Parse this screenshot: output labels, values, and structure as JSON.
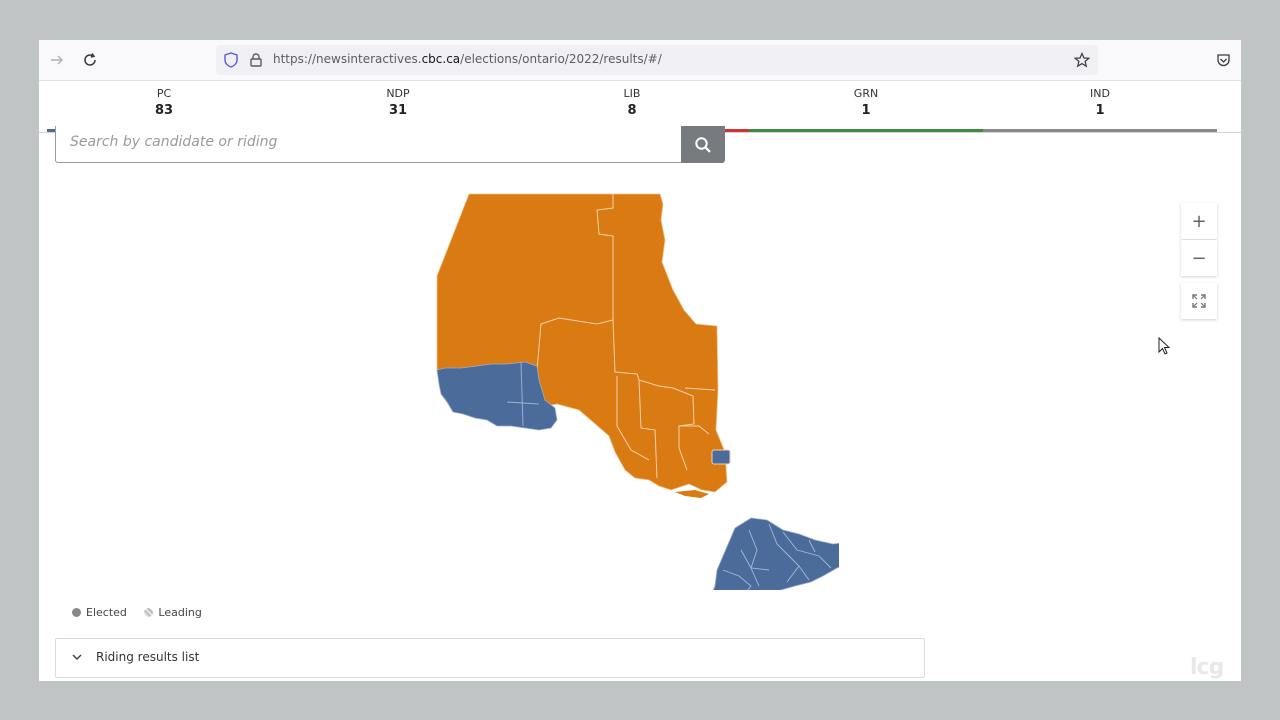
{
  "browser": {
    "url_prefix": "https://newsinteractives.",
    "url_domain": "cbc.ca",
    "url_suffix": "/elections/ontario/2022/results/#/"
  },
  "parties": [
    {
      "abbr": "PC",
      "seats": "83",
      "color": "#4a6a9a"
    },
    {
      "abbr": "NDP",
      "seats": "31",
      "color": "#e07b10"
    },
    {
      "abbr": "LIB",
      "seats": "8",
      "color": "#d33232"
    },
    {
      "abbr": "GRN",
      "seats": "1",
      "color": "#3f8c3f"
    },
    {
      "abbr": "IND",
      "seats": "1",
      "color": "#8a8a8a"
    }
  ],
  "search": {
    "placeholder": "Search by candidate or riding"
  },
  "map": {
    "region_colors": {
      "ndp": "#d97a13",
      "pc": "#4b6b9b",
      "lib": "#d33232"
    },
    "zoom_in": "+",
    "zoom_out": "−"
  },
  "legend": {
    "elected": "Elected",
    "leading": "Leading"
  },
  "riding_list": {
    "label": "Riding results list"
  },
  "watermark": "lcg"
}
